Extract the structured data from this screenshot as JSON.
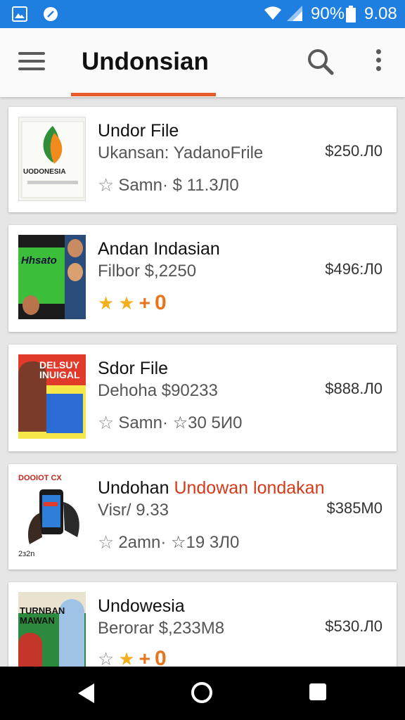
{
  "status_bar": {
    "battery_percent": "90%",
    "time": "9.08",
    "icons": [
      "gallery-icon",
      "app-icon",
      "wifi-icon",
      "signal-icon",
      "battery-icon"
    ]
  },
  "app_bar": {
    "title": "Undonsian",
    "accent_color": "#e85a2a",
    "icons": [
      "menu-icon",
      "search-icon",
      "more-vert-icon"
    ]
  },
  "items": [
    {
      "title": "Undor File",
      "subtitle": "Ukansan: YadanoFrile",
      "meta": "Samn· $ 11.3Л0",
      "price": "$250.Л0",
      "thumb_text": "UODONESIA"
    },
    {
      "title": "Andan Indasian",
      "subtitle": "Filbor $,2250",
      "rating_value": "0",
      "price": "$496:Л0",
      "thumb_text": "Hhsato"
    },
    {
      "title": "Sdor File",
      "subtitle": "Dehoha $90233",
      "meta": "Samn· ☆30 5И0",
      "price": "$888.Л0",
      "thumb_text": "DELSUY INUIGAL"
    },
    {
      "title": "Undohan",
      "title_accent": "Undowan londakan",
      "subtitle": "Visr/ 9.33",
      "meta": "2amn· ☆19 3Л0",
      "price": "$385M0",
      "thumb_text": "DOOIOT CX",
      "thumb_caption": "2з2n"
    },
    {
      "title": "Undowesia",
      "subtitle": "Berorar $,233M8",
      "rating_value": "0",
      "price": "$530.Л0",
      "thumb_text": "TURNBAN MAWAN"
    }
  ]
}
